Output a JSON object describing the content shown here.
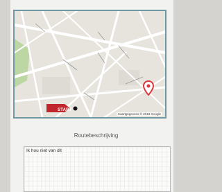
{
  "map": {
    "start_label": "START",
    "attribution": "Kaartgegevens © 2018 Google",
    "start_marker_color": "#c0262b",
    "destination_pin_color": "#d9383e",
    "park_color": "#bcd6a4"
  },
  "route": {
    "heading": "Routebeschrijving",
    "description_text": "Ik hou niet van dit"
  }
}
